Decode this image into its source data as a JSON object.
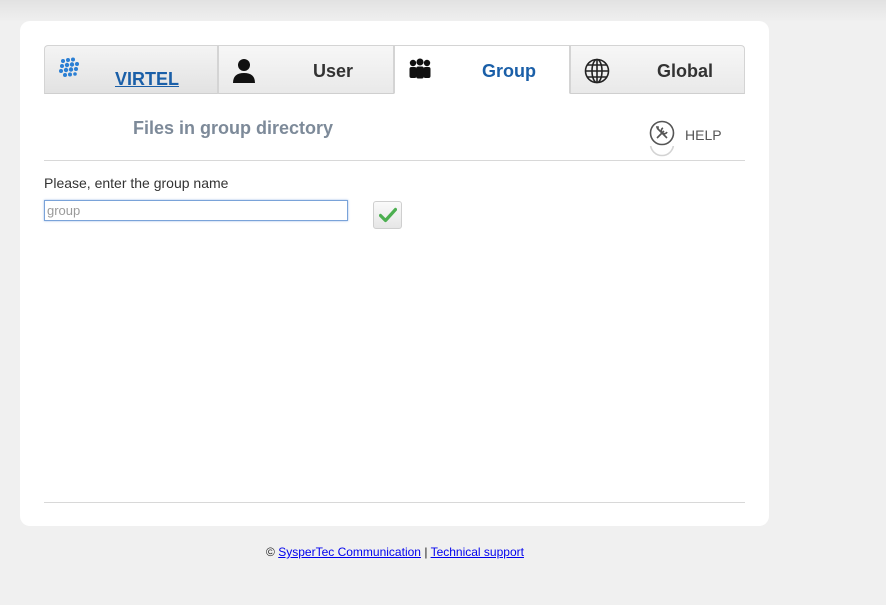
{
  "tabs": [
    {
      "label": "VIRTEL",
      "icon": "virtel-logo-icon",
      "active": false
    },
    {
      "label": "User",
      "icon": "user-icon",
      "active": false
    },
    {
      "label": "Group",
      "icon": "group-icon",
      "active": true
    },
    {
      "label": "Global",
      "icon": "globe-icon",
      "active": false
    }
  ],
  "page": {
    "title": "Files in group directory",
    "help_label": "HELP",
    "help_icon": "tools-icon"
  },
  "form": {
    "prompt": "Please, enter the group name",
    "input_value": "",
    "input_placeholder": "group",
    "submit_icon": "checkmark-icon"
  },
  "footer": {
    "copyright": "©",
    "company_link": "SysperTec Communication",
    "separator": "|",
    "support_link": "Technical support"
  },
  "colors": {
    "accent": "#1a5fa8",
    "title": "#7d8a99",
    "check": "#4caf50",
    "background": "#f0f0f0"
  }
}
